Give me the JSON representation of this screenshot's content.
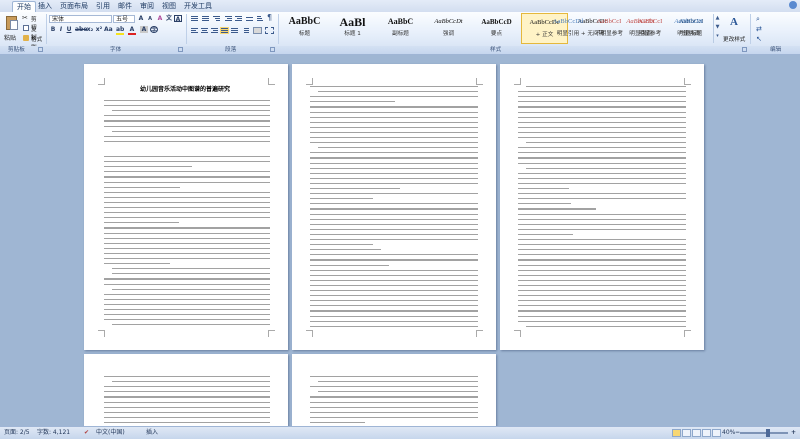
{
  "tabs": [
    "开始",
    "插入",
    "页面布局",
    "引用",
    "邮件",
    "审阅",
    "视图",
    "开发工具"
  ],
  "active_tab": "开始",
  "clipboard": {
    "paste_label": "粘贴",
    "cut_label": "剪切",
    "copy_label": "复制",
    "format_painter_label": "格式刷",
    "group_label": "剪贴板"
  },
  "font": {
    "name": "宋体",
    "size": "五号",
    "group_label": "字体"
  },
  "paragraph": {
    "group_label": "段落"
  },
  "styles": {
    "group_label": "样式",
    "items": [
      {
        "sample": "AaBbC",
        "name": "标题"
      },
      {
        "sample": "AaBl",
        "name": "标题 1"
      },
      {
        "sample": "AaBbC",
        "name": "副标题"
      },
      {
        "sample": "AaBbCcDt",
        "name": "强调"
      },
      {
        "sample": "AaBbCcD",
        "name": "要点"
      },
      {
        "sample": "AaBbCcDc",
        "name": "+ 正文"
      },
      {
        "sample": "AaBbCcDc",
        "name": "+ 无间隔"
      },
      {
        "sample": "AaBbCcDt",
        "name": "明显强调"
      },
      {
        "sample": "AaBbCcDt",
        "name": "明显强调"
      }
    ],
    "selected_index": 5,
    "extra": [
      {
        "sample": "AaBbCcDd",
        "name": "明显引用"
      },
      {
        "sample": "AaBbCcI",
        "name": "不明显参考"
      },
      {
        "sample": "AaBbCcI",
        "name": "明显参考"
      },
      {
        "sample": "AaBbCcI",
        "name": "书籍标题"
      }
    ],
    "change_styles_label": "更改样式"
  },
  "editing": {
    "group_label": "编辑"
  },
  "document": {
    "title": "幼儿园音乐活动中图谱的普遍研究"
  },
  "status": {
    "page": "页面: 2/5",
    "words": "字数: 4,121",
    "language": "中文(中国)",
    "mode": "插入",
    "zoom": "40%"
  },
  "colors": {
    "ribbon_bg": "#e8f0fb",
    "doc_bg": "#9fb6d3",
    "accent": "#2b5797"
  }
}
